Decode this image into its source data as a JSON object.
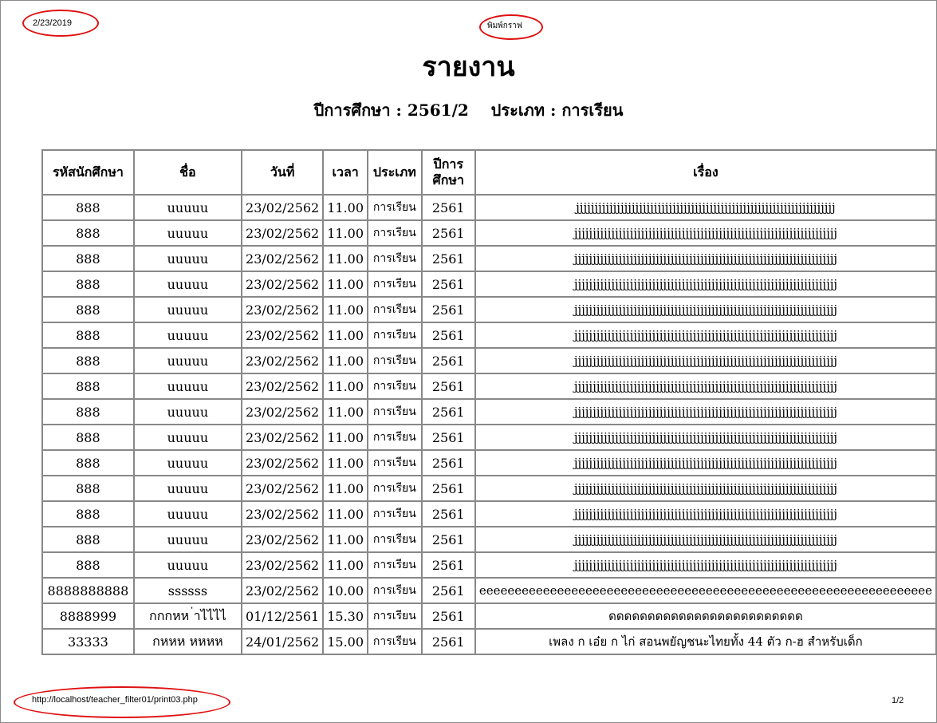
{
  "print_header": {
    "date": "2/23/2019",
    "print_link": "พิมพ์กราฟ"
  },
  "report": {
    "title": "รายงาน",
    "subtitle": "ปีการศึกษา : 2561/2    ประเภท : การเรียน"
  },
  "table": {
    "headers": [
      "รหัสนักศึกษา",
      "ชื่อ",
      "วันที่",
      "เวลา",
      "ประเภท",
      "ปีการ ศึกษา",
      "เรื่อง"
    ],
    "rows": [
      [
        "888",
        "uuuuu",
        "23/02/2562",
        "11.00",
        "การเรียน",
        "2561",
        "jjjjjjjjjjjjjjjjjjjjjjjjjjjjjjjjjjjjjjjjjjjjjjjjjjjjjjjjjjjjjjjjjjjjjj"
      ],
      [
        "888",
        "uuuuu",
        "23/02/2562",
        "11.00",
        "การเรียน",
        "2561",
        "jjjjjjjjjjjjjjjjjjjjjjjjjjjjjjjjjjjjjjjjjjjjjjjjjjjjjjjjjjjjjjjjjjjjjjj"
      ],
      [
        "888",
        "uuuuu",
        "23/02/2562",
        "11.00",
        "การเรียน",
        "2561",
        "jjjjjjjjjjjjjjjjjjjjjjjjjjjjjjjjjjjjjjjjjjjjjjjjjjjjjjjjjjjjjjjjjjjjjjj"
      ],
      [
        "888",
        "uuuuu",
        "23/02/2562",
        "11.00",
        "การเรียน",
        "2561",
        "jjjjjjjjjjjjjjjjjjjjjjjjjjjjjjjjjjjjjjjjjjjjjjjjjjjjjjjjjjjjjjjjjjjjjjj"
      ],
      [
        "888",
        "uuuuu",
        "23/02/2562",
        "11.00",
        "การเรียน",
        "2561",
        "jjjjjjjjjjjjjjjjjjjjjjjjjjjjjjjjjjjjjjjjjjjjjjjjjjjjjjjjjjjjjjjjjjjjjjj"
      ],
      [
        "888",
        "uuuuu",
        "23/02/2562",
        "11.00",
        "การเรียน",
        "2561",
        "jjjjjjjjjjjjjjjjjjjjjjjjjjjjjjjjjjjjjjjjjjjjjjjjjjjjjjjjjjjjjjjjjjjjjjj"
      ],
      [
        "888",
        "uuuuu",
        "23/02/2562",
        "11.00",
        "การเรียน",
        "2561",
        "jjjjjjjjjjjjjjjjjjjjjjjjjjjjjjjjjjjjjjjjjjjjjjjjjjjjjjjjjjjjjjjjjjjjjjj"
      ],
      [
        "888",
        "uuuuu",
        "23/02/2562",
        "11.00",
        "การเรียน",
        "2561",
        "jjjjjjjjjjjjjjjjjjjjjjjjjjjjjjjjjjjjjjjjjjjjjjjjjjjjjjjjjjjjjjjjjjjjjjj"
      ],
      [
        "888",
        "uuuuu",
        "23/02/2562",
        "11.00",
        "การเรียน",
        "2561",
        "jjjjjjjjjjjjjjjjjjjjjjjjjjjjjjjjjjjjjjjjjjjjjjjjjjjjjjjjjjjjjjjjjjjjjjj"
      ],
      [
        "888",
        "uuuuu",
        "23/02/2562",
        "11.00",
        "การเรียน",
        "2561",
        "jjjjjjjjjjjjjjjjjjjjjjjjjjjjjjjjjjjjjjjjjjjjjjjjjjjjjjjjjjjjjjjjjjjjjjj"
      ],
      [
        "888",
        "uuuuu",
        "23/02/2562",
        "11.00",
        "การเรียน",
        "2561",
        "jjjjjjjjjjjjjjjjjjjjjjjjjjjjjjjjjjjjjjjjjjjjjjjjjjjjjjjjjjjjjjjjjjjjjjj"
      ],
      [
        "888",
        "uuuuu",
        "23/02/2562",
        "11.00",
        "การเรียน",
        "2561",
        "jjjjjjjjjjjjjjjjjjjjjjjjjjjjjjjjjjjjjjjjjjjjjjjjjjjjjjjjjjjjjjjjjjjjjjj"
      ],
      [
        "888",
        "uuuuu",
        "23/02/2562",
        "11.00",
        "การเรียน",
        "2561",
        "jjjjjjjjjjjjjjjjjjjjjjjjjjjjjjjjjjjjjjjjjjjjjjjjjjjjjjjjjjjjjjjjjjjjjjj"
      ],
      [
        "888",
        "uuuuu",
        "23/02/2562",
        "11.00",
        "การเรียน",
        "2561",
        "jjjjjjjjjjjjjjjjjjjjjjjjjjjjjjjjjjjjjjjjjjjjjjjjjjjjjjjjjjjjjjjjjjjjjjj"
      ],
      [
        "888",
        "uuuuu",
        "23/02/2562",
        "11.00",
        "การเรียน",
        "2561",
        "jjjjjjjjjjjjjjjjjjjjjjjjjjjjjjjjjjjjjjjjjjjjjjjjjjjjjjjjjjjjjjjjjjjjjjj"
      ],
      [
        "8888888888",
        "ssssss",
        "23/02/2562",
        "10.00",
        "การเรียน",
        "2561",
        "eeeeeeeeeeeeeeeeeeeeeeeeeeeeeeeeeeeeeeeeeeeeeeeeeeeeeeeeeeeeeeee"
      ],
      [
        "8888999",
        "กกกหห ่าไไไไ",
        "01/12/2561",
        "15.30",
        "การเรียน",
        "2561",
        "ดดดดดดดดดดดดดดดดดดดดดดดดด"
      ],
      [
        "33333",
        "กหหห หหหห",
        "24/01/2562",
        "15.00",
        "การเรียน",
        "2561",
        "เพลง ก เอ๋ย ก ไก่ สอนพยัญชนะไทยทั้ง 44 ตัว ก-ฮ สำหรับเด็ก"
      ]
    ]
  },
  "print_footer": {
    "url": "http://localhost/teacher_filter01/print03.php",
    "page": "1/2"
  },
  "annotation": {
    "color": "#e01010"
  }
}
